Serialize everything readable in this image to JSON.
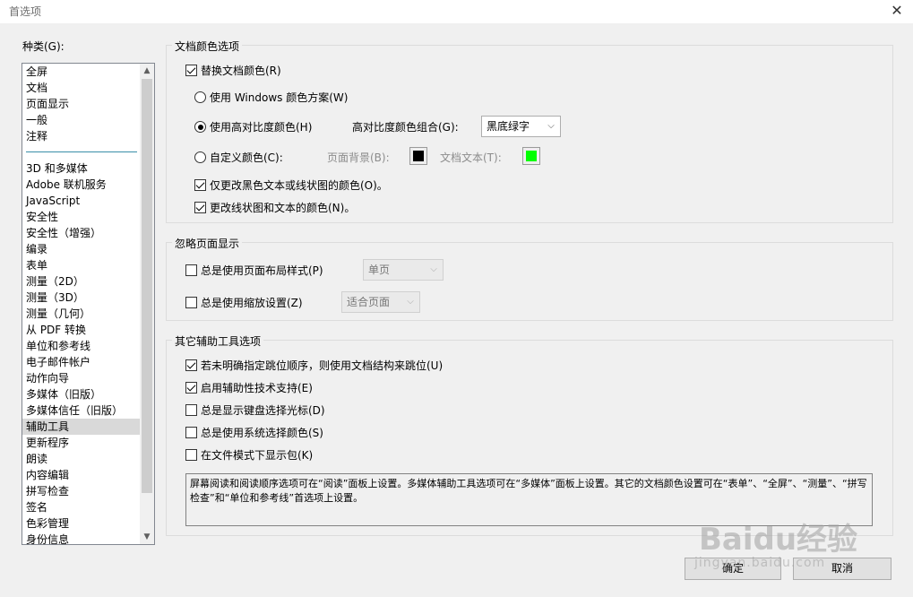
{
  "window": {
    "title": "首选项"
  },
  "categories": {
    "label": "种类(G):",
    "items_top": [
      "全屏",
      "文档",
      "页面显示",
      "一般",
      "注释"
    ],
    "items": [
      "3D 和多媒体",
      "Adobe 联机服务",
      "JavaScript",
      "安全性",
      "安全性（增强）",
      "编录",
      "表单",
      "测量（2D）",
      "测量（3D）",
      "测量（几何）",
      "从 PDF 转换",
      "单位和参考线",
      "电子邮件帐户",
      "动作向导",
      "多媒体（旧版）",
      "多媒体信任（旧版）",
      "辅助工具",
      "更新程序",
      "朗读",
      "内容编辑",
      "拼写检查",
      "签名",
      "色彩管理",
      "身份信息"
    ],
    "selected": "辅助工具"
  },
  "doc_colors": {
    "title": "文档颜色选项",
    "replace_colors": {
      "label": "替换文档颜色(R)",
      "checked": true
    },
    "use_windows": {
      "label": "使用 Windows 颜色方案(W)",
      "selected": false
    },
    "use_high_contrast": {
      "label": "使用高对比度颜色(H)",
      "selected": true
    },
    "high_contrast_combo_label": "高对比度颜色组合(G):",
    "high_contrast_combo_value": "黑底绿字",
    "custom_color": {
      "label": "自定义颜色(C):",
      "selected": false
    },
    "page_bg_label": "页面背景(B):",
    "page_bg_color": "#000000",
    "doc_text_label": "文档文本(T):",
    "doc_text_color": "#00ff00",
    "only_black_text": {
      "label": "仅更改黑色文本或线状图的颜色(O)。",
      "checked": true
    },
    "change_line_art": {
      "label": "更改线状图和文本的颜色(N)。",
      "checked": true
    }
  },
  "override_display": {
    "title": "忽略页面显示",
    "page_layout": {
      "label": "总是使用页面布局样式(P)",
      "checked": false,
      "value": "单页"
    },
    "zoom": {
      "label": "总是使用缩放设置(Z)",
      "checked": false,
      "value": "适合页面"
    }
  },
  "other_options": {
    "title": "其它辅助工具选项",
    "items": [
      {
        "label": "若未明确指定跳位顺序，则使用文档结构来跳位(U)",
        "checked": true
      },
      {
        "label": "启用辅助性技术支持(E)",
        "checked": true
      },
      {
        "label": "总是显示键盘选择光标(D)",
        "checked": false
      },
      {
        "label": "总是使用系统选择颜色(S)",
        "checked": false
      },
      {
        "label": "在文件模式下显示包(K)",
        "checked": false
      }
    ],
    "info_text": "屏幕阅读和阅读顺序选项可在“阅读”面板上设置。多媒体辅助工具选项可在“多媒体”面板上设置。其它的文档颜色设置可在“表单”、“全屏”、“测量”、“拼写检查”和“单位和参考线”首选项上设置。"
  },
  "buttons": {
    "ok": "确定",
    "cancel": "取消"
  },
  "watermark": {
    "logo": "Baidu经验",
    "url": "jingyan.baidu.com"
  }
}
